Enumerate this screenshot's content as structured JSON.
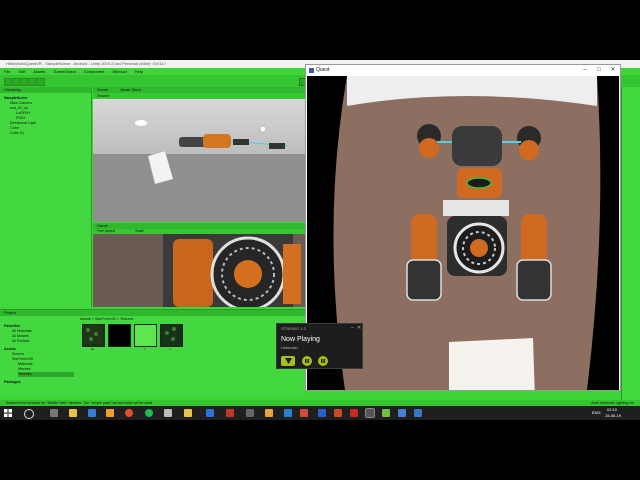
{
  "unity": {
    "title": "HelloWorldQuestVR - SampleScene - Android - Unity 2019.2.0a4 Personal (64bit) <DX11>",
    "menu": [
      "File",
      "Edit",
      "Assets",
      "GameObject",
      "Component",
      "Window",
      "Help"
    ],
    "hierarchy": {
      "tab": "Hierarchy",
      "scene_name": "SampleScene",
      "items": [
        "Main Camera",
        "ood_01_sp",
        "LoRESH",
        "FI003",
        "Directional Light",
        "Cube",
        "Cube (1)"
      ]
    },
    "scene_tabs": [
      "Scene",
      "Asset Store"
    ],
    "scene_toolbar": "Shaded",
    "game": {
      "tab": "Game",
      "aspect": "Free Aspect",
      "scale": "Scale"
    },
    "project": {
      "tab": "Project",
      "favorites_label": "Favorites",
      "favorites": [
        "All Materials",
        "All Models",
        "All Prefabs"
      ],
      "assets_label": "Assets",
      "assets": [
        "Scenes",
        "StarFrem100",
        "Materials",
        "Meshes",
        "Textures"
      ],
      "packages_label": "Packages",
      "breadcrumb": "Assets > StarFrem100 > Textures",
      "thumb_captions": [
        "ao",
        "",
        "c",
        "n"
      ]
    },
    "status": "Enabled text services for \"Mobile Web\" devices. The \"simple pass\" kernel mode will be used.",
    "status_right": "Auto Generate Lighting On"
  },
  "quest": {
    "title": "Quest",
    "controls": [
      "–",
      "□",
      "✕"
    ]
  },
  "stremio": {
    "header": "STREMIO 1.0",
    "title": "Now Playing",
    "subtitle": "Unknown"
  },
  "taskbar": {
    "lang": "ENG",
    "time": "02:10",
    "date": "15-08-19"
  },
  "colors": {
    "unity_green": "#3dd636",
    "stremio_accent": "#a0c21a"
  }
}
